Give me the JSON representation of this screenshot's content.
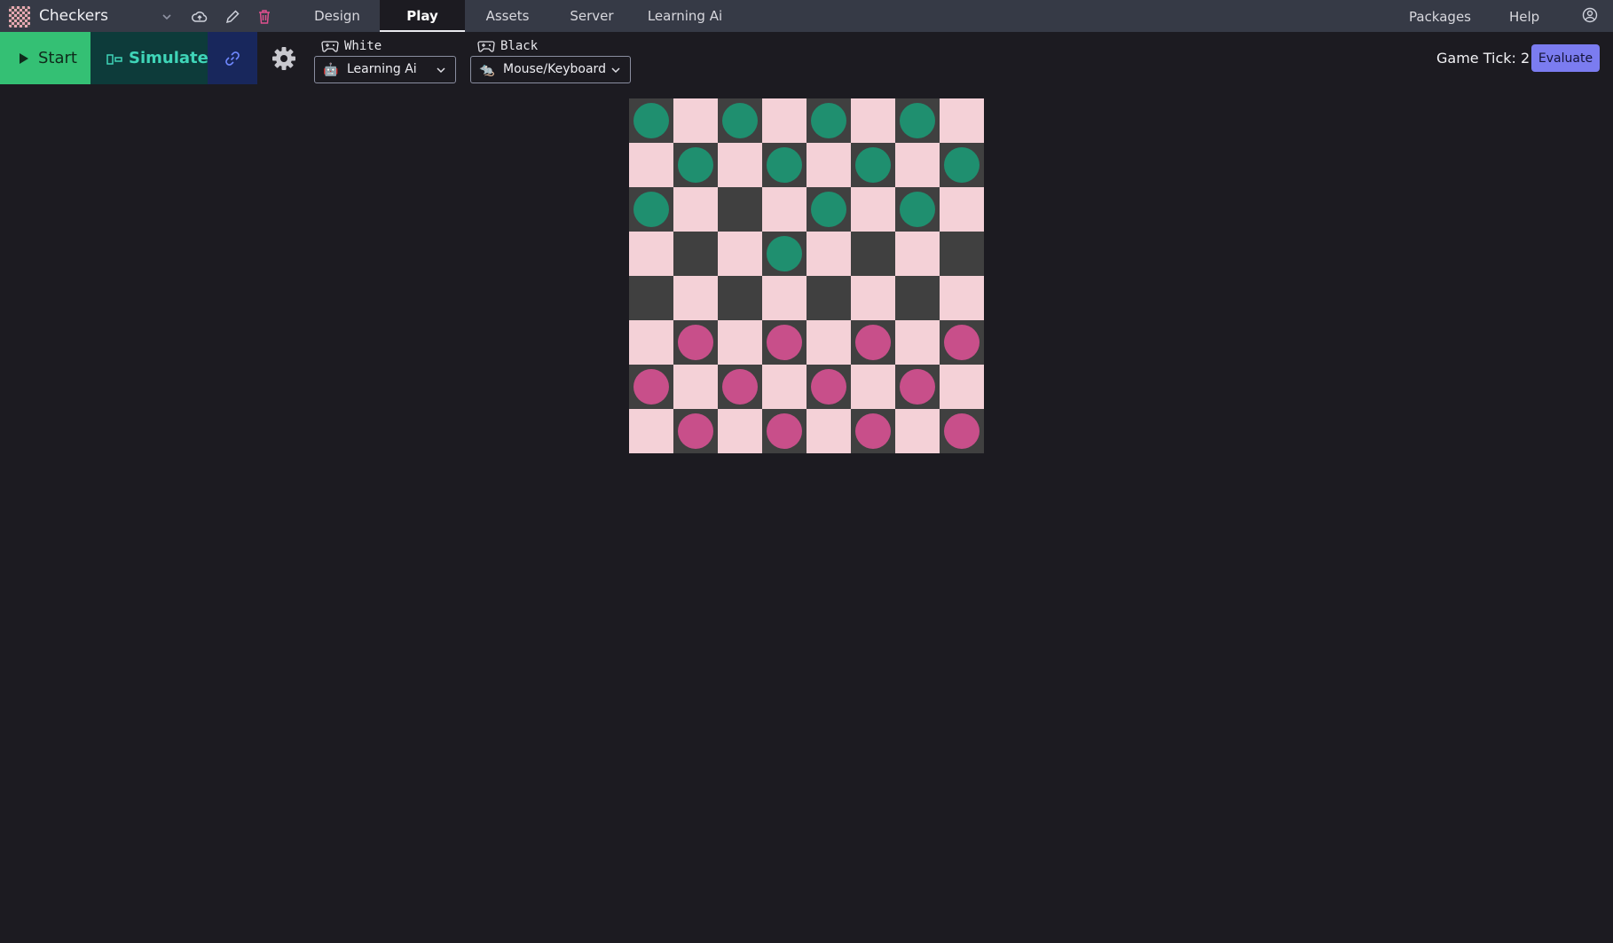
{
  "app": {
    "project_title": "Checkers"
  },
  "nav": {
    "tabs": [
      {
        "label": "Design",
        "active": false
      },
      {
        "label": "Play",
        "active": true
      },
      {
        "label": "Assets",
        "active": false
      },
      {
        "label": "Server",
        "active": false
      },
      {
        "label": "Learning Ai",
        "active": false
      }
    ],
    "right": [
      {
        "label": "Packages"
      },
      {
        "label": "Help"
      }
    ]
  },
  "toolbar": {
    "start_label": "Start",
    "simulate_label": "Simulate",
    "white_label": "White",
    "white_value": "Learning Ai",
    "white_icon": "🤖",
    "black_label": "Black",
    "black_value": "Mouse/Keyboard",
    "black_icon": "🐀",
    "tick_text": "Game Tick: 2",
    "evaluate_label": "Evaluate"
  },
  "colors": {
    "light_square": "#f4d1d7",
    "dark_square": "#404040",
    "green_piece": "#1f8f6f",
    "pink_piece": "#c84f8a",
    "start_button": "#34c074",
    "evaluate_button": "#7b7cf0"
  },
  "board": {
    "rows": [
      "GLGLGLGL",
      "LGLGLGLG",
      "GLDLGLGL",
      "LDLGLDLD",
      "DLDLDLDL",
      "LPLPLPLP",
      "PLPLPLPL",
      "LPLPLPLP"
    ],
    "legend": {
      "L": "light square",
      "D": "dark square",
      "G": "green piece on dark square",
      "P": "pink piece on dark square"
    }
  }
}
